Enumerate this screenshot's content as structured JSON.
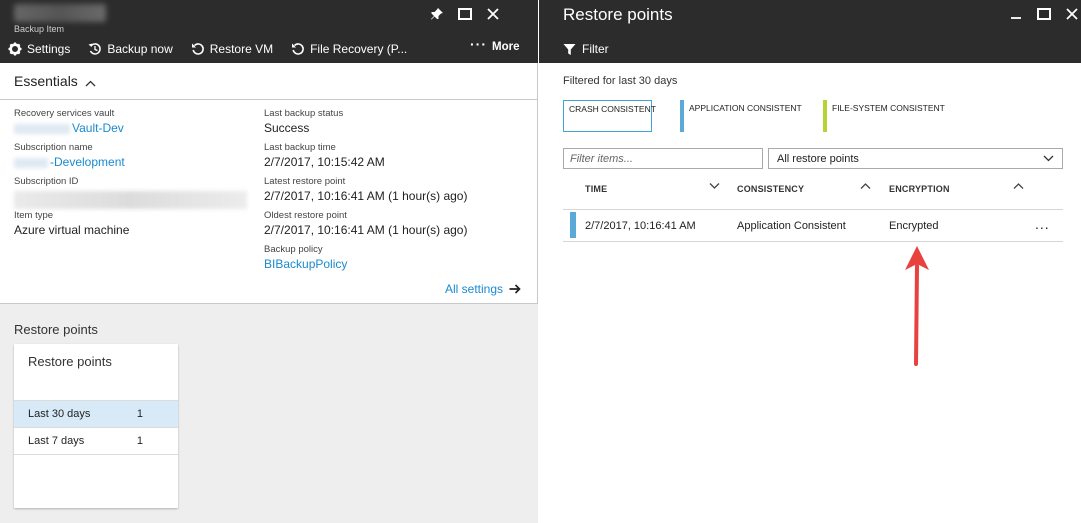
{
  "left_blade": {
    "subtitle": "Backup Item",
    "toolbar": {
      "settings": "Settings",
      "backup_now": "Backup now",
      "restore_vm": "Restore VM",
      "file_recovery": "File Recovery (P...",
      "more": "More"
    },
    "essentials": {
      "title": "Essentials",
      "left": [
        {
          "label": "Recovery services vault",
          "value": "Vault-Dev"
        },
        {
          "label": "Subscription name",
          "value": "-Development"
        },
        {
          "label": "Subscription ID",
          "value": ""
        },
        {
          "label": "Item type",
          "value": "Azure virtual machine"
        }
      ],
      "right": [
        {
          "label": "Last backup status",
          "value": "Success"
        },
        {
          "label": "Last backup time",
          "value": "2/7/2017, 10:15:42 AM"
        },
        {
          "label": "Latest restore point",
          "value": "2/7/2017, 10:16:41 AM (1 hour(s) ago)"
        },
        {
          "label": "Oldest restore point",
          "value": "2/7/2017, 10:16:41 AM (1 hour(s) ago)"
        },
        {
          "label": "Backup policy",
          "value": "BIBackupPolicy"
        }
      ],
      "all_settings": "All settings"
    },
    "restore_points_section": {
      "title": "Restore points",
      "tile_title": "Restore points",
      "rows": [
        {
          "label": "Last 30 days",
          "count": "1"
        },
        {
          "label": "Last 7 days",
          "count": "1"
        }
      ]
    }
  },
  "right_blade": {
    "title": "Restore points",
    "filter_label": "Filter",
    "filtered_for": "Filtered for last 30 days",
    "legend": [
      {
        "label": "CRASH CONSISTENT",
        "color": "#0b1f6e"
      },
      {
        "label": "APPLICATION CONSISTENT",
        "color": "#5aa9d6"
      },
      {
        "label": "FILE-SYSTEM CONSISTENT",
        "color": "#b5d334"
      }
    ],
    "filter_placeholder": "Filter items...",
    "select_value": "All restore points",
    "columns": [
      "TIME",
      "CONSISTENCY",
      "ENCRYPTION"
    ],
    "rows": [
      {
        "time": "2/7/2017, 10:16:41 AM",
        "consistency": "Application Consistent",
        "encryption": "Encrypted",
        "more": "..."
      }
    ]
  },
  "colors": {
    "header_bg": "#2c2c2c",
    "link": "#1a8ad0",
    "annotation_arrow": "#e8423f"
  }
}
